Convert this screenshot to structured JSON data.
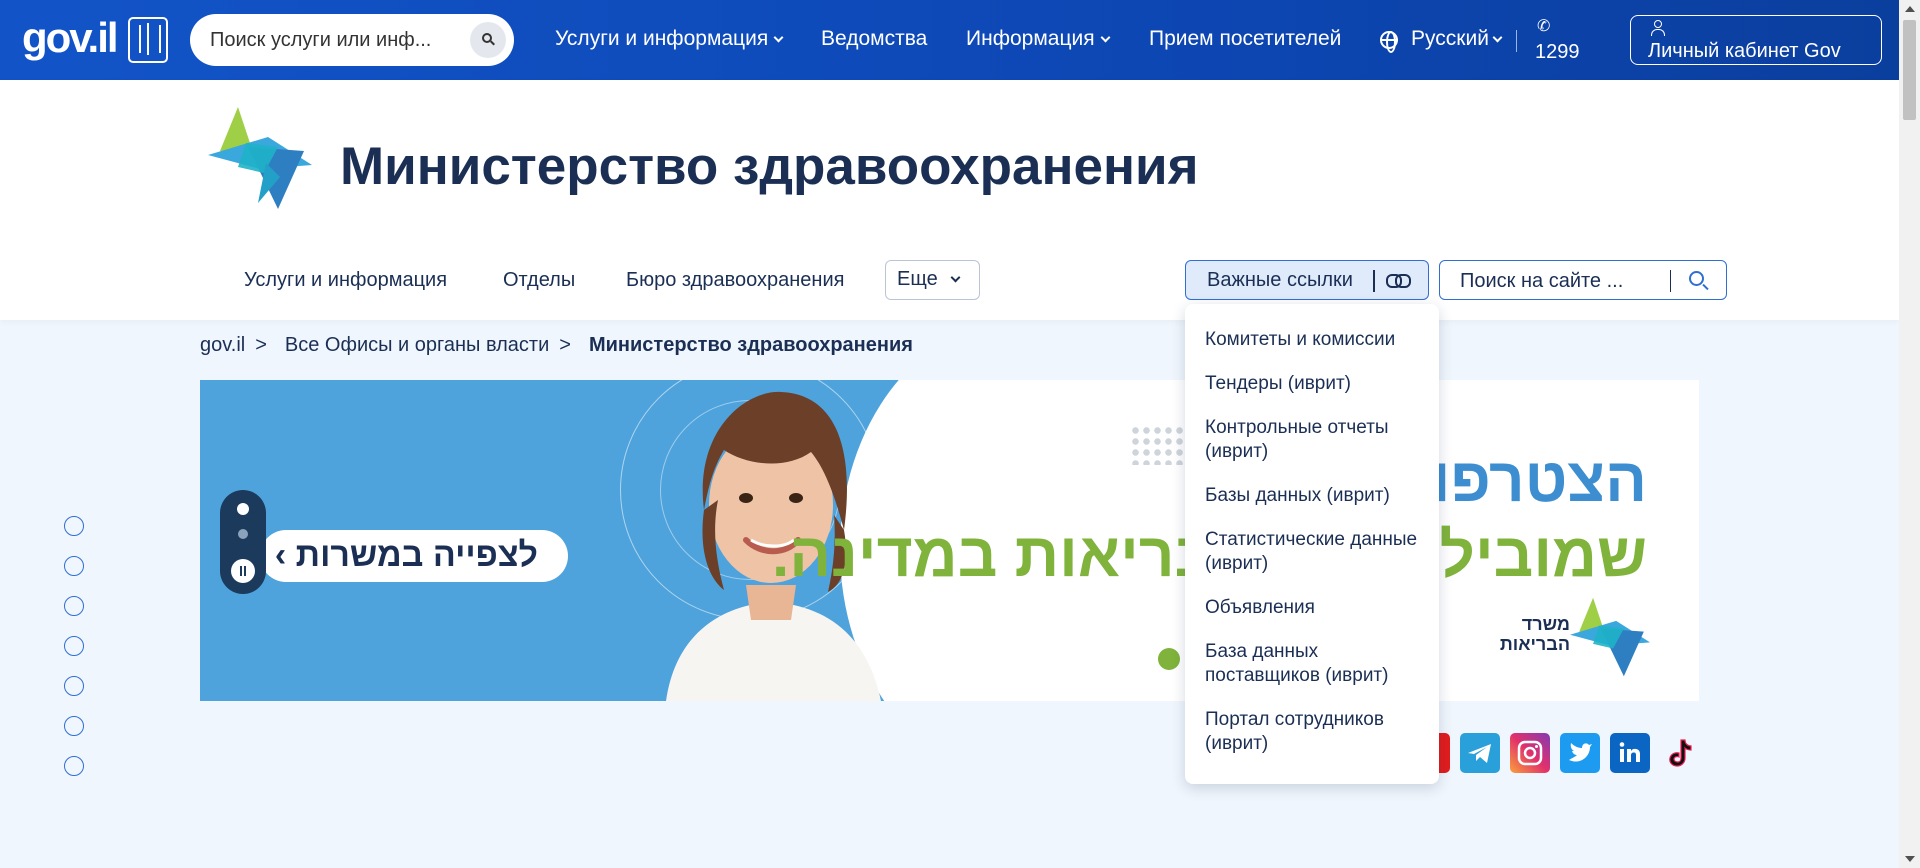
{
  "topbar": {
    "logo": "gov.il",
    "search_placeholder": "Поиск услуги или инф...",
    "nav": [
      {
        "label": "Услуги и информация"
      },
      {
        "label": "Ведомства"
      },
      {
        "label": "Информация"
      },
      {
        "label": "Прием посетителей"
      }
    ],
    "language": "Русский",
    "phone": "1299",
    "cabinet": "Личный кабинет Gov"
  },
  "ministry": {
    "title": "Министерство здравоохранения",
    "subnav": [
      "Услуги и информация",
      "Отделы",
      "Бюро здравоохранения"
    ],
    "more": "Еще",
    "important_links": "Важные ссылки",
    "site_search_placeholder": "Поиск на сайте ..."
  },
  "breadcrumb": {
    "items": [
      "gov.il",
      "Все Офисы и органы власти"
    ],
    "current": "Министерство здравоохранения",
    "separator": ">"
  },
  "banner": {
    "watch_label": "לצפייה במשרות ›",
    "headline_1": "הצטרפו ל",
    "headline_2": "שמובילים את הבריאות במדינה.",
    "brand": "משרד הבריאות"
  },
  "dropdown": {
    "items": [
      "Комитеты и комиссии",
      "Тендеры (иврит)",
      "Контрольные отчеты (иврит)",
      "Базы данных (иврит)",
      "Статистические данные (иврит)",
      "Объявления",
      "База данных поставщиков (иврит)",
      "Портал сотрудников (иврит)"
    ]
  },
  "social": [
    {
      "icon": "youtube-icon",
      "color": "#e11d1d"
    },
    {
      "icon": "telegram-icon",
      "color": "#2aa0da"
    },
    {
      "icon": "instagram-icon",
      "color": "#c7349b"
    },
    {
      "icon": "twitter-icon",
      "color": "#1d9bf0"
    },
    {
      "icon": "linkedin-icon",
      "color": "#0a66c2"
    },
    {
      "icon": "tiktok-icon",
      "color": "#111111"
    }
  ],
  "colors": {
    "topbar": "#0d47b4",
    "accent": "#2f6fd2",
    "title": "#1b2f55",
    "background": "#f0f6fd"
  }
}
